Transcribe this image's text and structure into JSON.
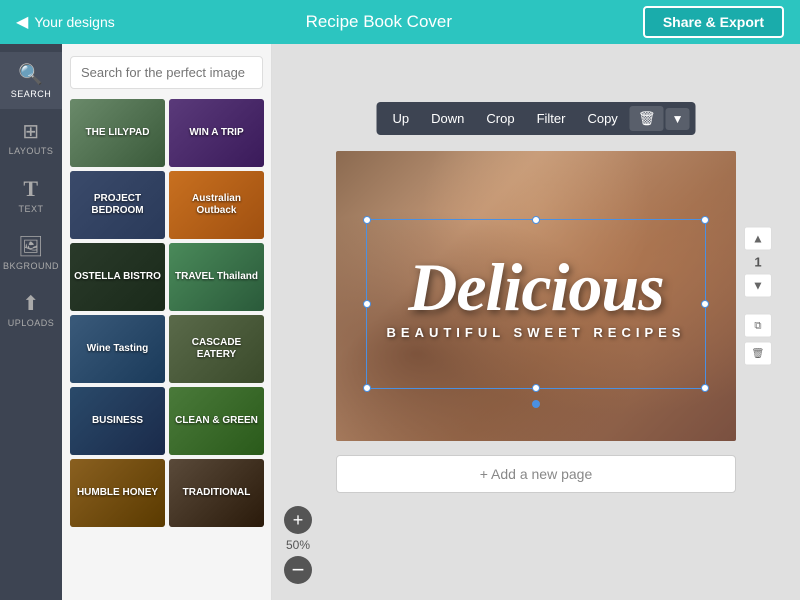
{
  "topbar": {
    "back_label": "Your designs",
    "title": "Recipe Book Cover",
    "share_label": "Share & Export"
  },
  "sidebar": {
    "items": [
      {
        "id": "search",
        "label": "SEARCH",
        "icon": "🔍",
        "active": true
      },
      {
        "id": "layouts",
        "label": "LAYOUTS",
        "icon": "⊞"
      },
      {
        "id": "text",
        "label": "TEXT",
        "icon": "T"
      },
      {
        "id": "background",
        "label": "BKGROUND",
        "icon": "🖼"
      },
      {
        "id": "uploads",
        "label": "UPLOADS",
        "icon": "⬆"
      }
    ]
  },
  "panel": {
    "search_placeholder": "Search for the perfect image",
    "templates": [
      {
        "id": 1,
        "label": "THE LILYPAD",
        "class": "t1"
      },
      {
        "id": 2,
        "label": "WIN A TRIP",
        "class": "t2"
      },
      {
        "id": 3,
        "label": "PROJECT BEDROOM",
        "class": "t3"
      },
      {
        "id": 4,
        "label": "Australian Outback",
        "class": "t4"
      },
      {
        "id": 5,
        "label": "OSTELLA BISTRO",
        "class": "t5"
      },
      {
        "id": 6,
        "label": "TRAVEL Thailand",
        "class": "t6"
      },
      {
        "id": 7,
        "label": "Wine Tasting",
        "class": "t7"
      },
      {
        "id": 8,
        "label": "CASCADE EATERY",
        "class": "t8"
      },
      {
        "id": 9,
        "label": "BUSINESS",
        "class": "t9"
      },
      {
        "id": 10,
        "label": "CLEAN & GREEN",
        "class": "t10"
      },
      {
        "id": 11,
        "label": "HUMBLE HONEY",
        "class": "t11"
      },
      {
        "id": 12,
        "label": "TRADITIONAL",
        "class": "t12"
      }
    ]
  },
  "toolbar": {
    "up": "Up",
    "down": "Down",
    "crop": "Crop",
    "filter": "Filter",
    "copy": "Copy"
  },
  "canvas": {
    "main_text": "Delicious",
    "subtitle": "BEAUTIFUL SWEET RECIPES",
    "add_page": "+ Add a new page"
  },
  "zoom": {
    "level": "50%",
    "plus_label": "+",
    "minus_label": "−"
  },
  "right_tools": {
    "up_arrow": "▲",
    "page_num": "1",
    "down_arrow": "▼"
  }
}
